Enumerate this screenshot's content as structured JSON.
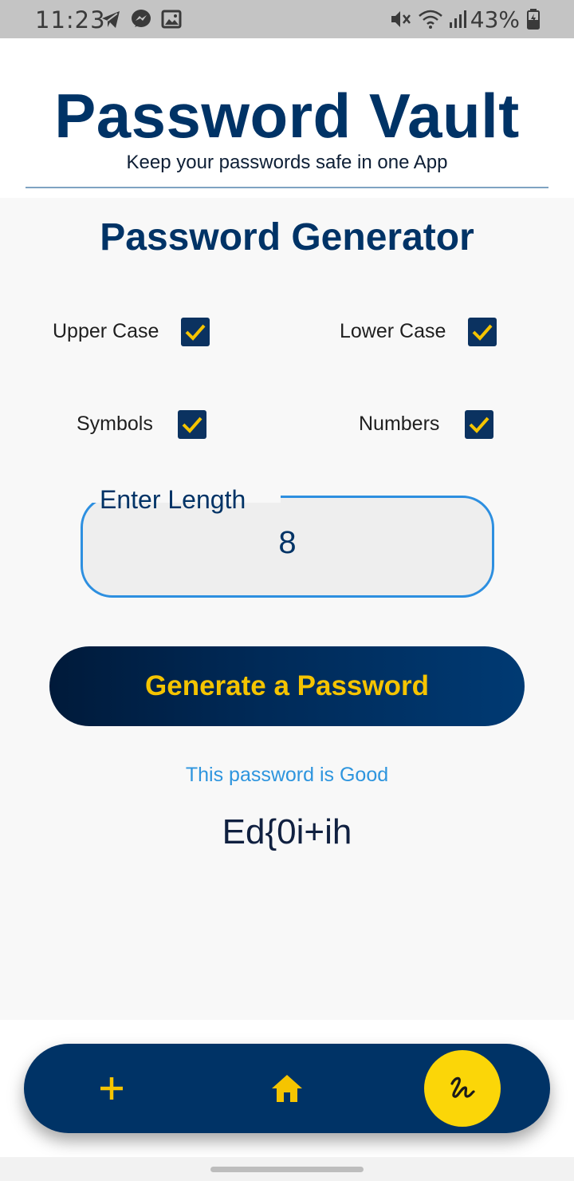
{
  "status_bar": {
    "time": "11:23",
    "battery": "43%",
    "left_icons": [
      "telegram-icon",
      "messenger-icon",
      "gallery-icon"
    ],
    "right_icons": [
      "mute-icon",
      "wifi-icon",
      "signal-icon",
      "battery-icon"
    ]
  },
  "header": {
    "title": "Password Vault",
    "subtitle": "Keep your passwords safe in one App"
  },
  "generator": {
    "title": "Password Generator",
    "options": {
      "upper_case": {
        "label": "Upper Case",
        "checked": true
      },
      "lower_case": {
        "label": "Lower Case",
        "checked": true
      },
      "symbols": {
        "label": "Symbols",
        "checked": true
      },
      "numbers": {
        "label": "Numbers",
        "checked": true
      }
    },
    "length": {
      "label": "Enter Length",
      "value": "8"
    },
    "generate_label": "Generate a Password",
    "strength_text": "This password is Good",
    "password": "Ed{0i+ih"
  },
  "bottom_nav": {
    "items": [
      "add-icon",
      "home-icon",
      "generator-icon"
    ],
    "active": "generator-icon"
  },
  "colors": {
    "primary": "#003366",
    "accent": "#f5c400",
    "field_border": "#2d8fe0",
    "strength": "#2e95de"
  }
}
